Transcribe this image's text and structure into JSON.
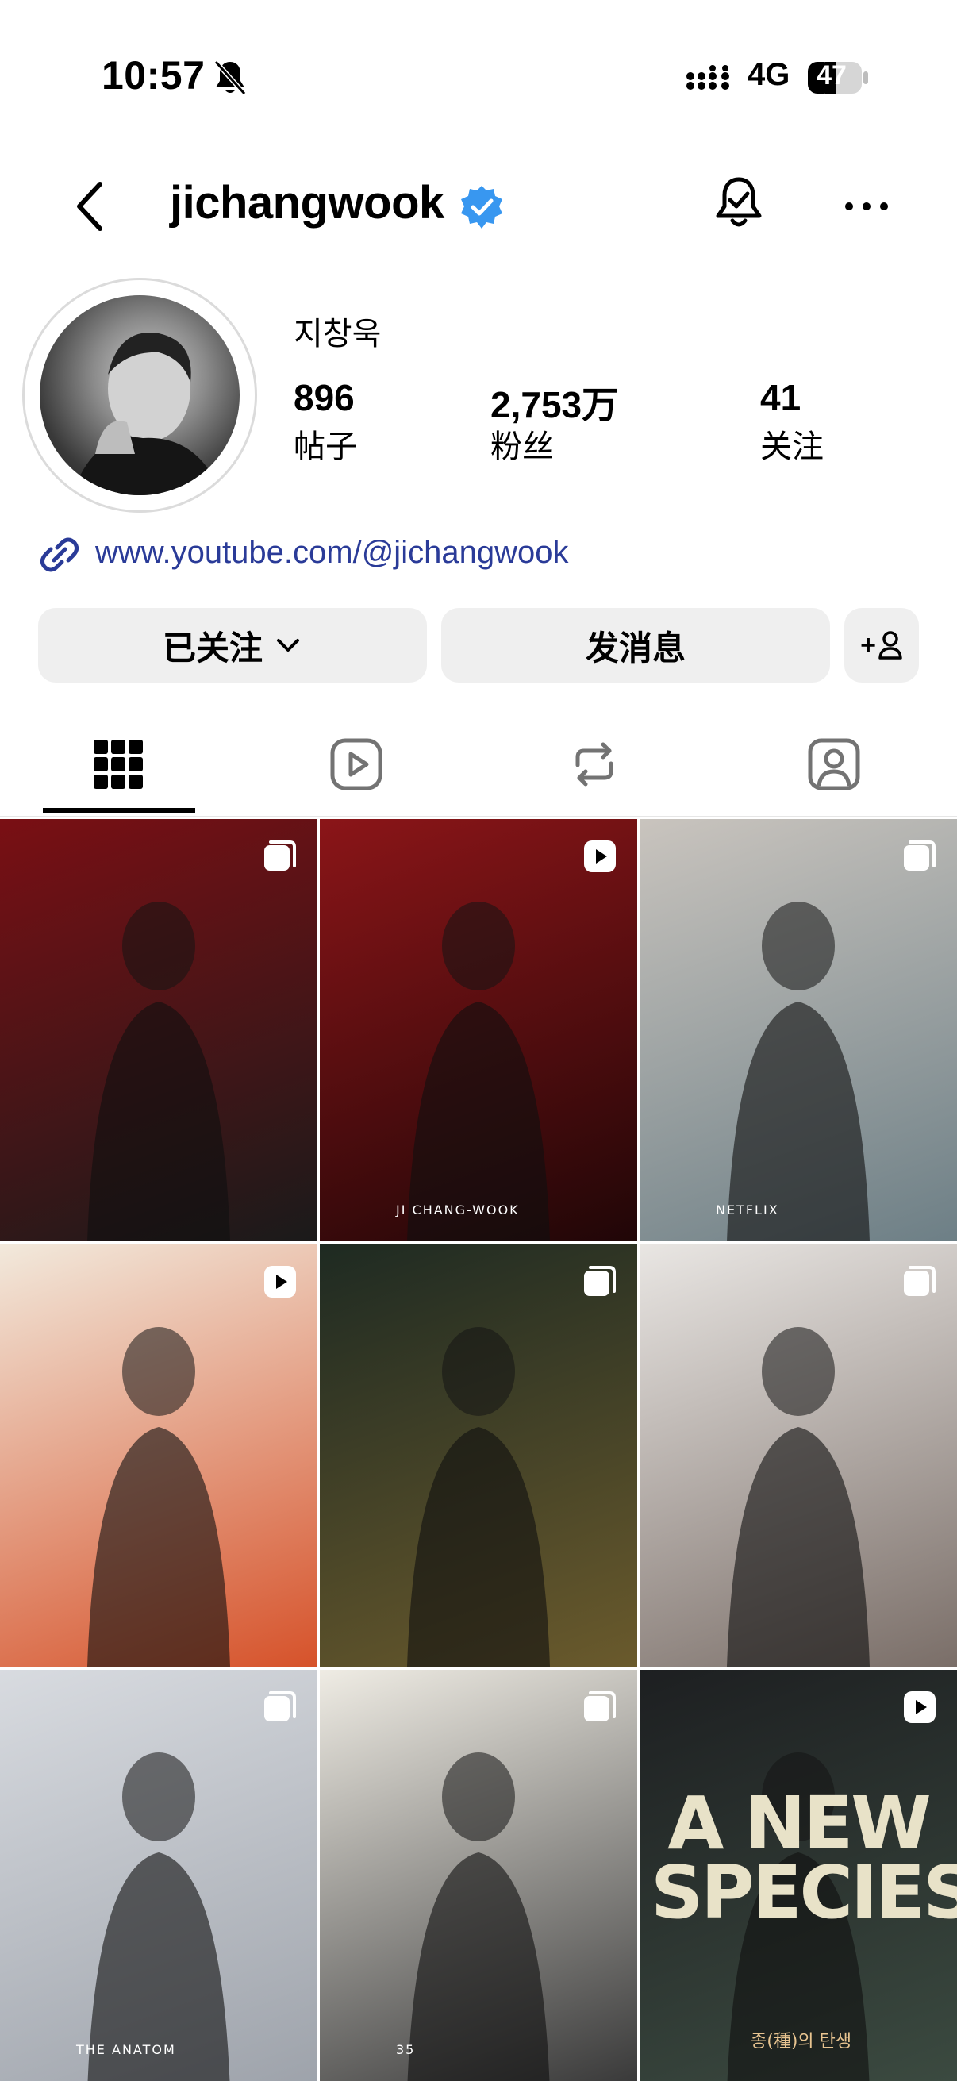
{
  "status_bar": {
    "time": "10:57",
    "network": "4G",
    "battery": "47"
  },
  "header": {
    "username": "jichangwook"
  },
  "profile": {
    "display_name": "지창욱",
    "stats": [
      {
        "value": "896",
        "label": "帖子"
      },
      {
        "value": "2,753万",
        "label": "粉丝"
      },
      {
        "value": "41",
        "label": "关注"
      }
    ],
    "website": "www.youtube.com/@jichangwook"
  },
  "actions": {
    "following": "已关注",
    "message": "发消息",
    "add_friend": "+"
  },
  "tabs": [
    "grid-icon",
    "reels-icon",
    "reposts-icon",
    "tagged-icon"
  ],
  "posts": [
    {
      "type": "carousel",
      "colors": [
        "#7a0f14",
        "#1a1a1a"
      ]
    },
    {
      "type": "reel",
      "colors": [
        "#8b1518",
        "#200607"
      ],
      "caption": "JI CHANG-WOOK"
    },
    {
      "type": "carousel",
      "colors": [
        "#c9c4be",
        "#6d7f86"
      ],
      "caption": "NETFLIX"
    },
    {
      "type": "reel",
      "colors": [
        "#f2e9dc",
        "#d6522a"
      ]
    },
    {
      "type": "carousel",
      "colors": [
        "#1e2a22",
        "#6a5a2c"
      ]
    },
    {
      "type": "carousel",
      "colors": [
        "#e9e6e3",
        "#7a6e68"
      ]
    },
    {
      "type": "carousel",
      "colors": [
        "#d8dbe0",
        "#9ea3ab"
      ],
      "caption": "THE ANATOM"
    },
    {
      "type": "carousel",
      "colors": [
        "#efece4",
        "#3a3a3a"
      ],
      "caption": "35"
    },
    {
      "type": "reel",
      "colors": [
        "#1d1f21",
        "#3b4a40"
      ],
      "caption": "A NEW SPECIES",
      "caption2": "종(種)의 탄생"
    }
  ]
}
